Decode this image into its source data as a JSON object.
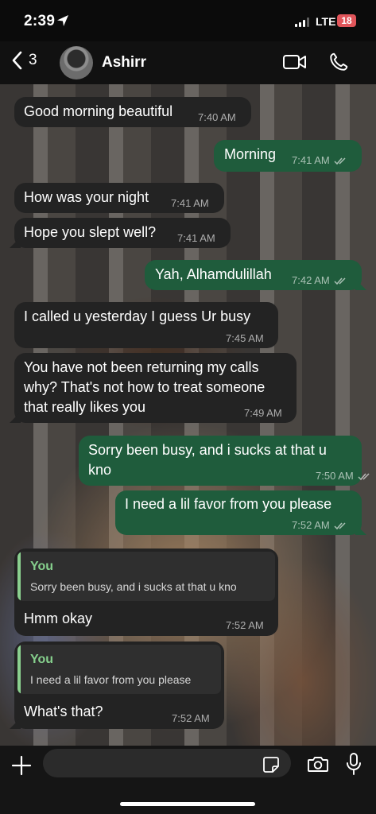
{
  "status_bar": {
    "time": "2:39",
    "network": "LTE",
    "battery": "18"
  },
  "header": {
    "back_count": "3",
    "contact_name": "Ashirr"
  },
  "messages": [
    {
      "text": "Good morning beautiful",
      "time": "7:40 AM"
    },
    {
      "text": "Morning",
      "time": "7:41 AM"
    },
    {
      "text": "How was your night",
      "time": "7:41 AM"
    },
    {
      "text": "Hope you slept well?",
      "time": "7:41 AM"
    },
    {
      "text": "Yah, Alhamdulillah",
      "time": "7:42 AM"
    },
    {
      "text": "I called u yesterday I guess Ur busy",
      "time": "7:45 AM"
    },
    {
      "lines": [
        "You have not been returning my calls",
        "why? That's not how to treat someone",
        "that really likes you"
      ],
      "time": "7:49 AM"
    },
    {
      "lines": [
        "Sorry been busy, and i sucks at that u",
        "kno"
      ],
      "time": "7:50 AM"
    },
    {
      "text": "I need a lil favor from you please",
      "time": "7:52 AM"
    },
    {
      "quote_author": "You",
      "quote_text": "Sorry been busy, and i sucks at that u kno",
      "text": "Hmm okay",
      "time": "7:52 AM"
    },
    {
      "quote_author": "You",
      "quote_text": "I need a lil favor from you please",
      "text": "What's that?",
      "time": "7:52 AM"
    }
  ],
  "colors": {
    "incoming_bubble": "#232323",
    "outgoing_bubble": "#1f5c3c",
    "quote_accent": "#86d08d",
    "battery": "#e0555a"
  },
  "icons": [
    "location-arrow-icon",
    "chevron-left-icon",
    "video-camera-icon",
    "phone-icon",
    "plus-icon",
    "sticker-icon",
    "camera-icon",
    "microphone-icon",
    "double-check-icon"
  ]
}
